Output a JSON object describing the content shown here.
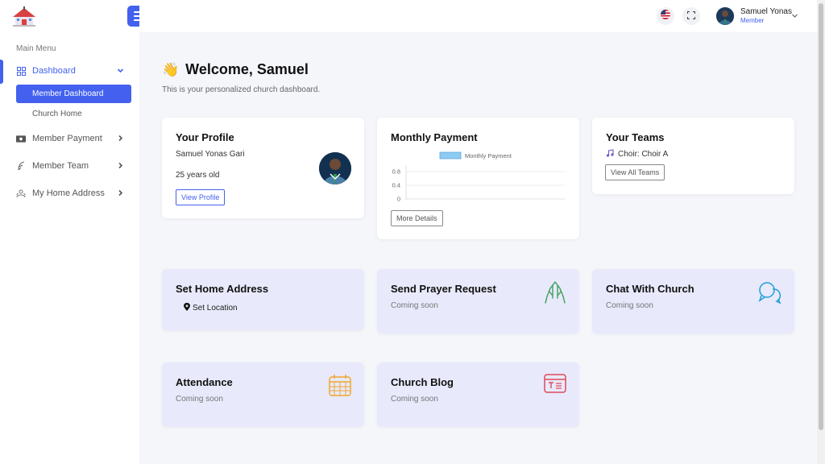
{
  "sidebar": {
    "menu_title": "Main Menu",
    "items": [
      {
        "label": "Dashboard",
        "icon": "grid-icon"
      },
      {
        "label": "Member Payment",
        "icon": "money-icon"
      },
      {
        "label": "Member Team",
        "icon": "feather-icon"
      },
      {
        "label": "My Home Address",
        "icon": "home-address-icon"
      }
    ],
    "sub_items": [
      {
        "label": "Member Dashboard"
      },
      {
        "label": "Church Home"
      }
    ]
  },
  "header": {
    "user_name": "Samuel Yonas",
    "user_role": "Member"
  },
  "main": {
    "welcome": "Welcome, Samuel",
    "subtitle": "This is your personalized church dashboard."
  },
  "profile": {
    "title": "Your Profile",
    "name": "Samuel Yonas Gari",
    "age": "25 years old",
    "button": "View Profile"
  },
  "payment": {
    "title": "Monthly Payment",
    "button": "More Details"
  },
  "teams": {
    "title": "Your Teams",
    "team": "Choir: Choir A",
    "button": "View All Teams"
  },
  "features": {
    "home": {
      "title": "Set Home Address",
      "action": "Set Location"
    },
    "prayer": {
      "title": "Send Prayer Request",
      "status": "Coming soon"
    },
    "chat": {
      "title": "Chat With Church",
      "status": "Coming soon"
    },
    "attendance": {
      "title": "Attendance",
      "status": "Coming soon"
    },
    "blog": {
      "title": "Church Blog",
      "status": "Coming soon"
    }
  },
  "colors": {
    "accent": "#4361ee",
    "feature_bg": "#e8e9fb",
    "prayer_icon": "#3aa05a",
    "chat_icon": "#1e9fd8",
    "attendance_icon": "#f0a830",
    "blog_icon": "#e04a5a"
  },
  "chart_data": {
    "type": "bar",
    "categories": [],
    "series": [
      {
        "name": "Monthly Payment",
        "values": []
      }
    ],
    "ylim": [
      0,
      1
    ],
    "yticks": [
      "0.8",
      "0.4",
      "0"
    ],
    "legend": "top"
  }
}
